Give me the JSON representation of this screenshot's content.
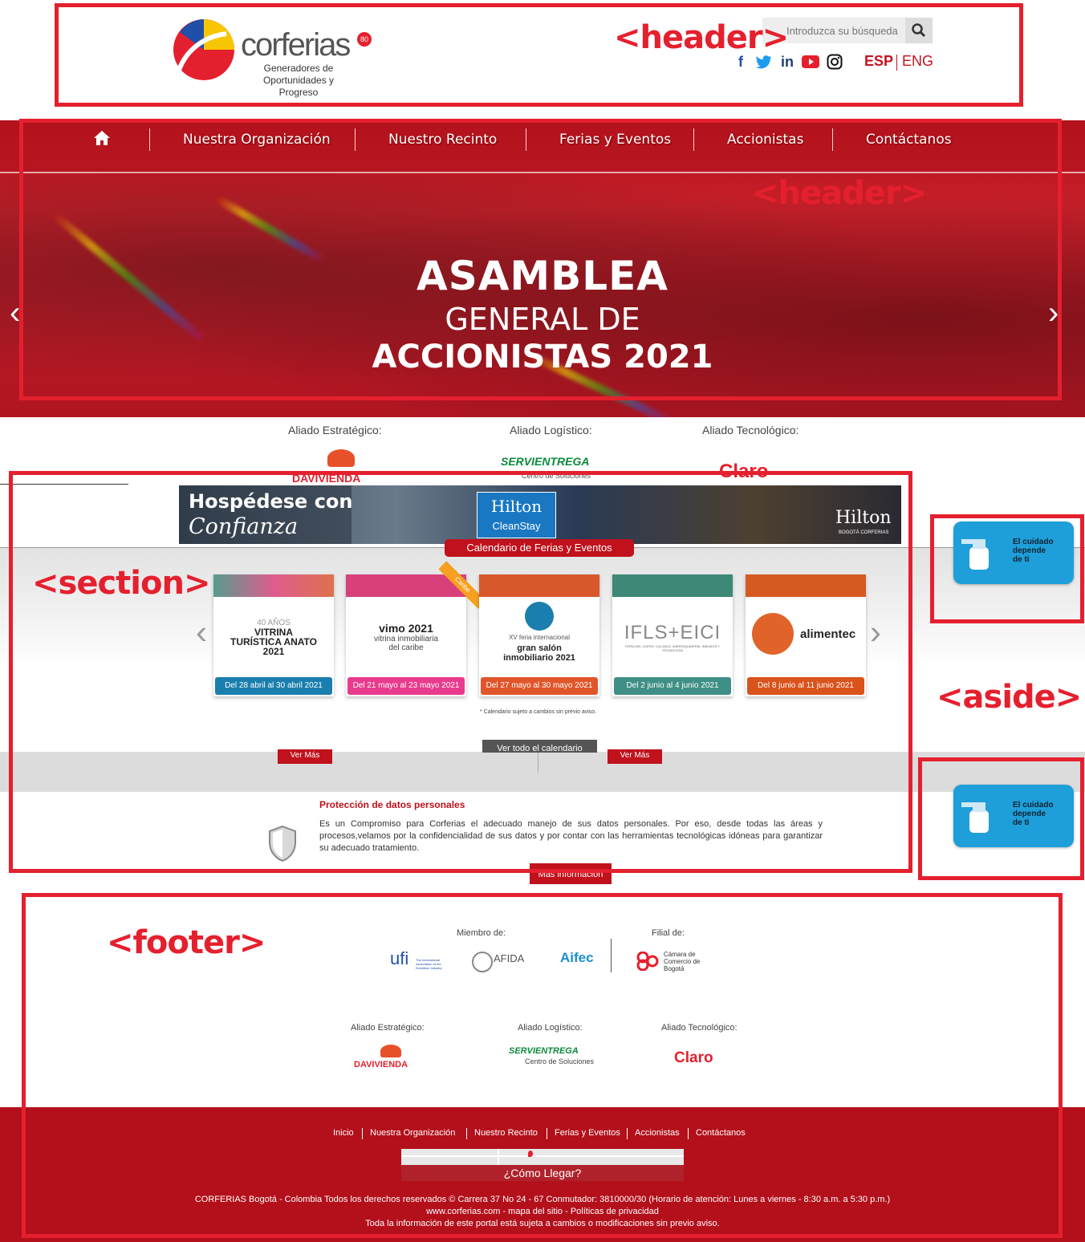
{
  "header": {
    "brand_name": "corferias",
    "brand_badge": "80",
    "tagline_1": "Generadores de",
    "tagline_2": "Oportunidades y Progreso",
    "search_placeholder": "Introduzca su búsqueda",
    "social": [
      "f",
      "twitter",
      "in",
      "youtube",
      "instagram"
    ],
    "lang_esp": "ESP",
    "lang_eng": "ENG"
  },
  "nav": {
    "items": [
      "Nuestra Organización",
      "Nuestro Recinto",
      "Ferias y Eventos",
      "Accionistas",
      "Contáctanos"
    ]
  },
  "hero": {
    "line1": "ASAMBLEA",
    "line2": "GENERAL DE",
    "line3": "ACCIONISTAS 2021"
  },
  "allies_top": {
    "strategic_label": "Aliado Estratégico:",
    "logistic_label": "Aliado Logístico:",
    "tech_label": "Aliado Tecnológico:",
    "strategic": "DAVIVIENDA",
    "logistic": "SERVIENTREGA",
    "logistic_sub": "Centro de Soluciones",
    "tech": "Claro"
  },
  "hilton_banner": {
    "line1": "Hospédese con",
    "line2": "Confianza",
    "badge1": "Hilton",
    "badge2": "CleanStay",
    "brand": "Hilton",
    "brand_sub": "BOGOTÁ CORFERIAS"
  },
  "calendar": {
    "title": "Calendario de Ferias y Eventos",
    "cards": [
      {
        "name": "VITRINA TURÍSTICA ANATO 2021",
        "sub": "40 AÑOS",
        "date": "Del 28 abril al 30 abril 2021",
        "color": "#1a7fae",
        "top": "#3a8a7a"
      },
      {
        "name": "vimo 2021",
        "sub": "vitrina inmobiliaria del caribe",
        "date": "Del 21 mayo al 23 mayo 2021",
        "color": "#e83b8e",
        "top": "#d8407a",
        "ribbon": "Caribe"
      },
      {
        "name": "gran salón inmobiliario 2021",
        "sub": "XV feria internacional",
        "date": "Del 27 mayo al 30 mayo 2021",
        "color": "#e0562a",
        "top": "#d8582c"
      },
      {
        "name": "IFLS+EICI",
        "sub": "FERIA DEL CUERO, CALZADO, MARROQUINERÍA, INSUMOS Y TECNOLOGÍA",
        "date": "Del 2 junio al 4 junio 2021",
        "color": "#3f8f86",
        "top": "#3d8877"
      },
      {
        "name": "alimentec",
        "sub": "",
        "date": "Del 8 junio al 11 junio 2021",
        "color": "#d9531a",
        "top": "#d45a22"
      }
    ],
    "note": "* Calendario sujeto a cambios sin previo aviso.",
    "view_all": "Ver todo el calendario",
    "ver_mas": "Ver Más"
  },
  "privacy": {
    "title": "Protección de datos personales",
    "text": "Es un Compromiso para Corferias el adecuado manejo de sus datos personales. Por eso, desde todas las áreas y procesos,velamos por la confidencialidad de sus datos y por contar con las herramientas tecnológicas idóneas para garantizar su adecuado tratamiento.",
    "button": "Más información"
  },
  "aside": {
    "card_text_1": "El cuidado",
    "card_text_2": "depende",
    "card_text_3": "de ti"
  },
  "annotations": {
    "header1": "<header>",
    "header2": "<header>",
    "section": "<section>",
    "aside": "<aside>",
    "footer": "<footer>"
  },
  "footer": {
    "member_label": "Miembro de:",
    "filial_label": "Filial de:",
    "members": [
      "ufi",
      "AFIDA",
      "Aifec"
    ],
    "ufi_sub": "The International Association of the Exhibition Industry",
    "filial": "Cámara de Comercio de Bogotá",
    "strategic_label": "Aliado Estratégico:",
    "logistic_label": "Aliado Logístico:",
    "tech_label": "Aliado Tecnológico:",
    "strategic": "DAVIVIENDA",
    "logistic": "SERVIENTREGA",
    "logistic_sub": "Centro de Soluciones",
    "tech": "Claro",
    "links": [
      "Inicio",
      "Nuestra Organización",
      "Nuestro Recinto",
      "Ferias y Eventos",
      "Accionistas",
      "Contáctanos"
    ],
    "map_label": "¿Cómo Llegar?",
    "legal_1": "CORFERIAS Bogotá - Colombia Todos los derechos reservados © Carrera 37 No 24 - 67 Conmutador: 3810000/30 (Horario de atención: Lunes a viernes - 8:30 a.m. a 5:30 p.m.)",
    "legal_2": "www.corferias.com -  mapa del sitio  -  Políticas de privacidad",
    "legal_3": "Toda la información de este portal está sujeta a cambios o modificaciones sin previo aviso."
  }
}
